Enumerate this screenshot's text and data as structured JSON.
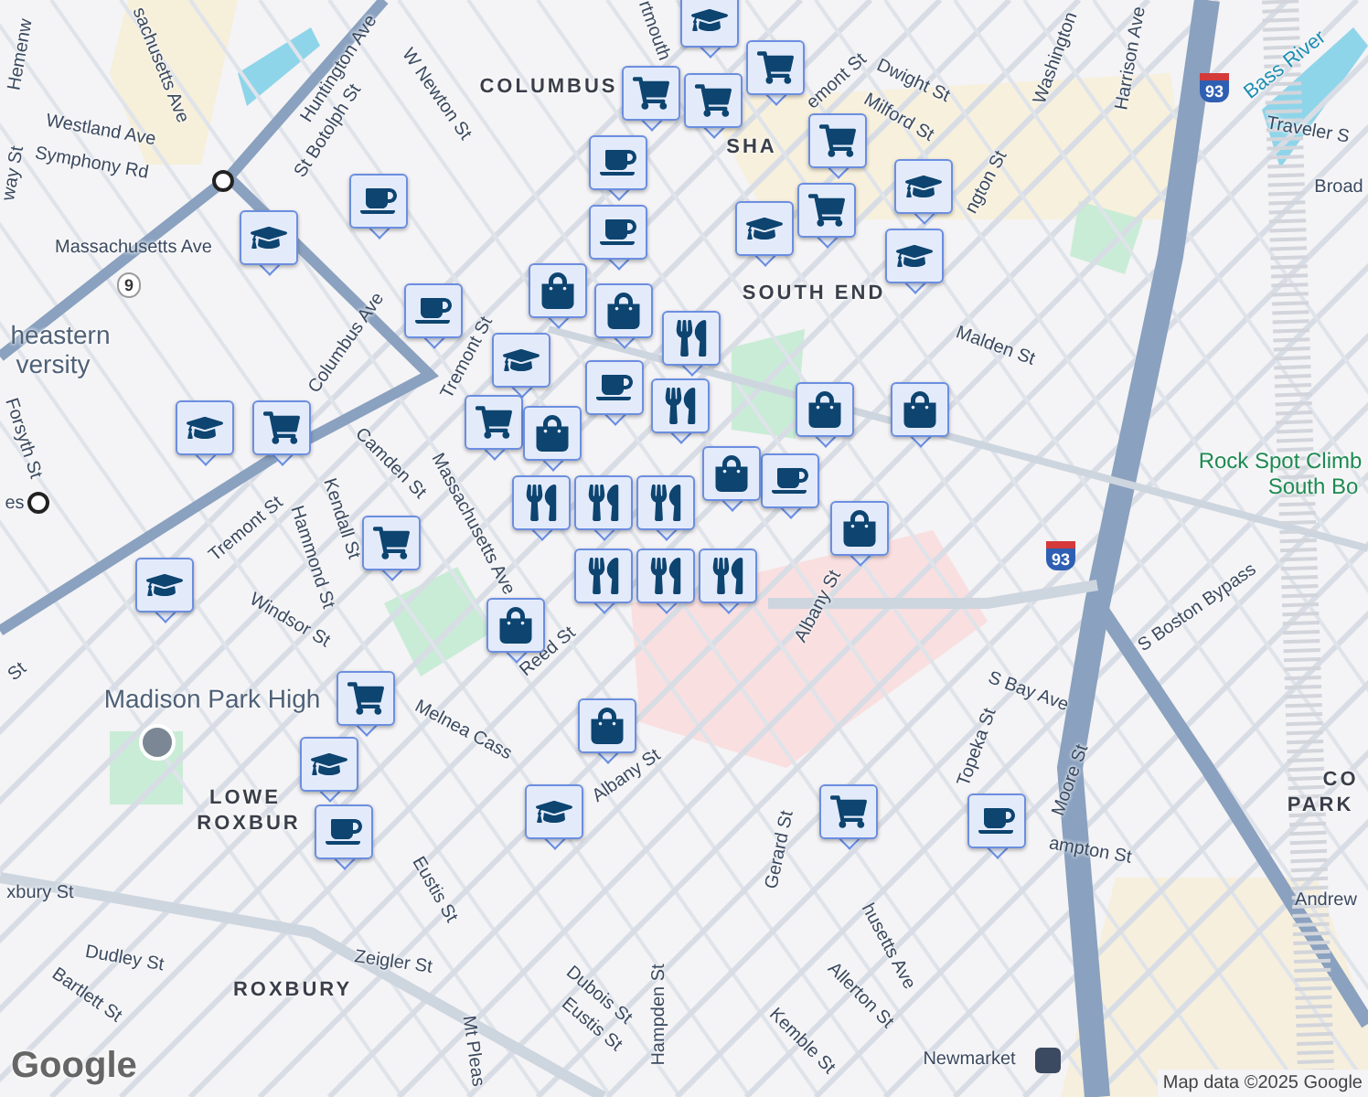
{
  "map": {
    "labels": [
      {
        "text": "Hemenw",
        "kind": "street"
      },
      {
        "text": "Westland Ave",
        "kind": "street"
      },
      {
        "text": "Symphony Rd",
        "kind": "street"
      },
      {
        "text": "way St",
        "kind": "street"
      },
      {
        "text": "sachusetts Ave",
        "kind": "street"
      },
      {
        "text": "Huntington Ave",
        "kind": "street"
      },
      {
        "text": "St Botolph St",
        "kind": "street"
      },
      {
        "text": "W Newton St",
        "kind": "street"
      },
      {
        "text": "COLUMBUS",
        "kind": "district"
      },
      {
        "text": "rtmouth",
        "kind": "street"
      },
      {
        "text": "Massachusetts Ave",
        "kind": "street"
      },
      {
        "text": "heastern",
        "kind": "poi"
      },
      {
        "text": "versity",
        "kind": "poi"
      },
      {
        "text": "Columbus Ave",
        "kind": "street"
      },
      {
        "text": "Tremont St",
        "kind": "street"
      },
      {
        "text": "Massachusetts Ave",
        "kind": "street"
      },
      {
        "text": "Tremont St",
        "kind": "street"
      },
      {
        "text": "Camden St",
        "kind": "street"
      },
      {
        "text": "Hammond St",
        "kind": "street"
      },
      {
        "text": "Kendall St",
        "kind": "street"
      },
      {
        "text": "Forsyth St",
        "kind": "street"
      },
      {
        "text": "es",
        "kind": "street"
      },
      {
        "text": "St",
        "kind": "street"
      },
      {
        "text": "Windsor St",
        "kind": "street"
      },
      {
        "text": "Madison Park High",
        "kind": "poi"
      },
      {
        "text": "Reed St",
        "kind": "street"
      },
      {
        "text": "Melnea Cass",
        "kind": "street"
      },
      {
        "text": "Albany St",
        "kind": "street"
      },
      {
        "text": "LOWE",
        "kind": "district"
      },
      {
        "text": "ROXBUR",
        "kind": "district"
      },
      {
        "text": "xbury St",
        "kind": "street"
      },
      {
        "text": "Dudley St",
        "kind": "street"
      },
      {
        "text": "Bartlett St",
        "kind": "street"
      },
      {
        "text": "ROXBURY",
        "kind": "district"
      },
      {
        "text": "Eustis St",
        "kind": "street"
      },
      {
        "text": "Zeigler St",
        "kind": "street"
      },
      {
        "text": "Dubois St",
        "kind": "street"
      },
      {
        "text": "Eustis St",
        "kind": "street"
      },
      {
        "text": "Hampden St",
        "kind": "street"
      },
      {
        "text": "Mt Pleas",
        "kind": "street"
      },
      {
        "text": "Gerard St",
        "kind": "street"
      },
      {
        "text": "Topeka St",
        "kind": "street"
      },
      {
        "text": "Moore St",
        "kind": "street"
      },
      {
        "text": "S Bay Ave",
        "kind": "street"
      },
      {
        "text": "S Boston Bypass",
        "kind": "street"
      },
      {
        "text": "ampton St",
        "kind": "street"
      },
      {
        "text": "husetts Ave",
        "kind": "street"
      },
      {
        "text": "Allerton St",
        "kind": "street"
      },
      {
        "text": "Kemble St",
        "kind": "street"
      },
      {
        "text": "Newmarket",
        "kind": "street"
      },
      {
        "text": "Malden St",
        "kind": "street"
      },
      {
        "text": "SOUTH END",
        "kind": "district"
      },
      {
        "text": "SHA",
        "kind": "district"
      },
      {
        "text": "Dwight St",
        "kind": "street"
      },
      {
        "text": "Milford St",
        "kind": "street"
      },
      {
        "text": "emont St",
        "kind": "street"
      },
      {
        "text": "Washington",
        "kind": "street"
      },
      {
        "text": "Harrison Ave",
        "kind": "street"
      },
      {
        "text": "Traveler S",
        "kind": "street"
      },
      {
        "text": "Broad",
        "kind": "street"
      },
      {
        "text": "Bass River",
        "kind": "water"
      },
      {
        "text": "Rock Spot Climb",
        "kind": "park"
      },
      {
        "text": "South Bo",
        "kind": "park"
      },
      {
        "text": "CO",
        "kind": "district"
      },
      {
        "text": "PARK",
        "kind": "district"
      },
      {
        "text": "Andrew",
        "kind": "street"
      },
      {
        "text": "Albany St",
        "kind": "street"
      },
      {
        "text": "ngton St",
        "kind": "street"
      }
    ],
    "shields": [
      {
        "text": "9",
        "kind": "state"
      },
      {
        "text": "93",
        "kind": "interstate"
      },
      {
        "text": "93",
        "kind": "interstate"
      }
    ],
    "markers": [
      {
        "kind": "school"
      },
      {
        "kind": "cart"
      },
      {
        "kind": "cart"
      },
      {
        "kind": "cart"
      },
      {
        "kind": "coffee"
      },
      {
        "kind": "coffee"
      },
      {
        "kind": "cart"
      },
      {
        "kind": "cart"
      },
      {
        "kind": "school"
      },
      {
        "kind": "school"
      },
      {
        "kind": "school"
      },
      {
        "kind": "coffee"
      },
      {
        "kind": "school"
      },
      {
        "kind": "coffee"
      },
      {
        "kind": "bag"
      },
      {
        "kind": "bag"
      },
      {
        "kind": "school"
      },
      {
        "kind": "restaurant"
      },
      {
        "kind": "restaurant"
      },
      {
        "kind": "coffee"
      },
      {
        "kind": "school"
      },
      {
        "kind": "cart"
      },
      {
        "kind": "cart"
      },
      {
        "kind": "bag"
      },
      {
        "kind": "restaurant"
      },
      {
        "kind": "restaurant"
      },
      {
        "kind": "restaurant"
      },
      {
        "kind": "bag"
      },
      {
        "kind": "bag"
      },
      {
        "kind": "coffee"
      },
      {
        "kind": "restaurant"
      },
      {
        "kind": "bag"
      },
      {
        "kind": "bag"
      },
      {
        "kind": "school"
      },
      {
        "kind": "cart"
      },
      {
        "kind": "bag"
      },
      {
        "kind": "restaurant"
      },
      {
        "kind": "restaurant"
      },
      {
        "kind": "cart"
      },
      {
        "kind": "school"
      },
      {
        "kind": "coffee"
      },
      {
        "kind": "bag"
      },
      {
        "kind": "school"
      },
      {
        "kind": "cart"
      },
      {
        "kind": "coffee"
      }
    ],
    "attribution": "Map data ©2025 Google",
    "logo": "Google"
  }
}
